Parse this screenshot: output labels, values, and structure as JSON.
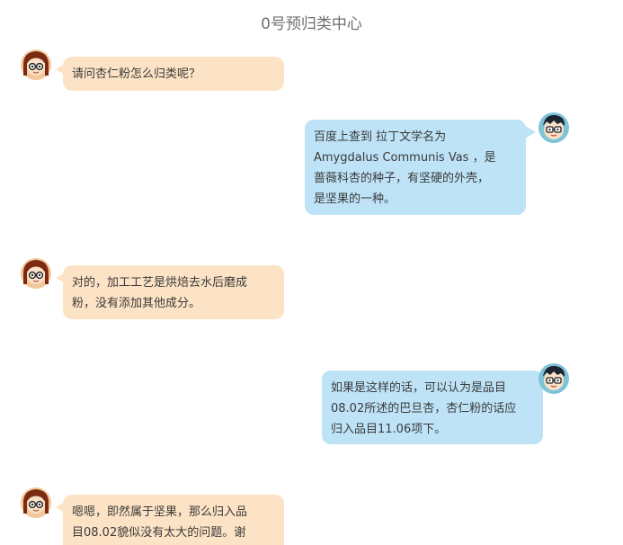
{
  "header": {
    "title": "0号预归类中心"
  },
  "messages": [
    {
      "speaker": "customer",
      "lines": [
        "请问杏仁粉怎么归类呢？"
      ]
    },
    {
      "speaker": "agent",
      "lines": [
        "百度上查到 拉丁文学名为",
        "Amygdalus Communis Vas ，是",
        "蔷薇科杏的种子，有坚硬的外壳，",
        "是坚果的一种。"
      ]
    },
    {
      "speaker": "customer",
      "lines": [
        "对的，加工工艺是烘焙去水后磨成",
        "粉，没有添加其他成分。"
      ]
    },
    {
      "speaker": "agent",
      "lines": [
        "如果是这样的话，可以认为是品目",
        "08.02所述的巴旦杏，杏仁粉的话应",
        "归入品目11.06项下。"
      ]
    },
    {
      "speaker": "customer",
      "lines": [
        "嗯嗯，即然属于坚果，那么归入品",
        "目08.02貌似没有太大的问题。谢"
      ]
    }
  ],
  "colors": {
    "customer_bubble": "#fde3c5",
    "agent_bubble": "#bee3f7",
    "text": "#3a3a3a"
  },
  "icons": {
    "customer_avatar": "girl-with-glasses-avatar-icon",
    "agent_avatar": "boy-with-glasses-avatar-icon"
  }
}
